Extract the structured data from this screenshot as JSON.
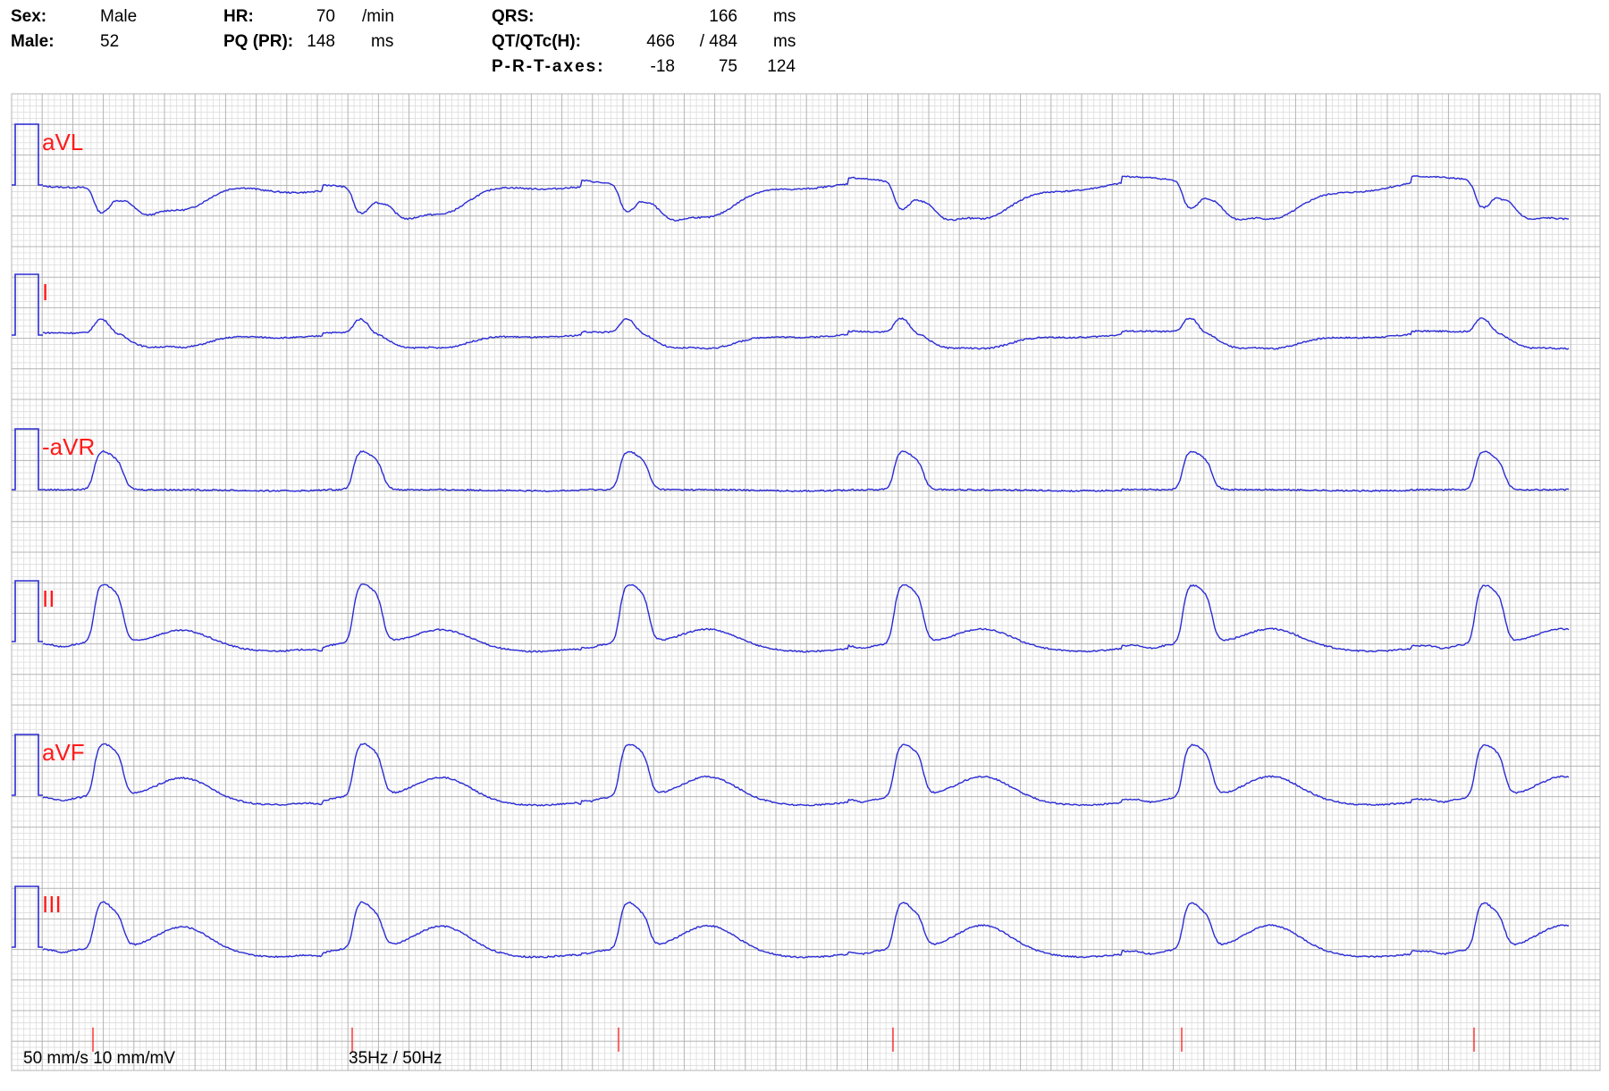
{
  "header": {
    "sex_label": "Sex:",
    "sex_value": "Male",
    "age_label": "Male:",
    "age_value": "52",
    "hr_label": "HR:",
    "hr_value": "70",
    "hr_unit": "/min",
    "pq_label": "PQ (PR):",
    "pq_value": "148",
    "pq_unit": "ms",
    "qrs_label": "QRS:",
    "qrs_value": "166",
    "qrs_unit": "ms",
    "qt_label": "QT/QTc(H):",
    "qt_value": "466",
    "qtc_value": "/ 484",
    "qt_unit": "ms",
    "axes_label": "P-R-T-axes:",
    "axis_p": "-18",
    "axis_r": "75",
    "axis_t": "124"
  },
  "footer": {
    "speed_gain": "50 mm/s 10 mm/mV",
    "filters": "35Hz / 50Hz"
  },
  "colors": {
    "trace": "#2b2bd6",
    "lead_label": "#ff1a1a",
    "grid_minor": "#dcdcdc",
    "grid_major": "#b4b4b4",
    "marker": "#ff1a1a"
  },
  "chart_data": {
    "type": "line",
    "paper_speed_mm_s": 50,
    "gain_mm_mV": 10,
    "heart_rate_bpm": 70,
    "leads": [
      {
        "name": "aVL",
        "beat_template": [
          0,
          0.05,
          0.0,
          -0.4,
          -0.15,
          -0.3,
          -0.5,
          -0.35,
          -0.2
        ]
      },
      {
        "name": "I",
        "beat_template": [
          0,
          0.05,
          0.0,
          0.3,
          0.1,
          -0.05,
          -0.25,
          -0.15,
          -0.1
        ]
      },
      {
        "name": "-aVR",
        "beat_template": [
          0,
          0.0,
          0.0,
          0.65,
          0.55,
          0.0,
          0.0,
          0.0,
          -0.02
        ]
      },
      {
        "name": "II",
        "beat_template": [
          0,
          -0.05,
          -0.05,
          0.95,
          0.85,
          0.05,
          0.25,
          0.0,
          -0.1
        ]
      },
      {
        "name": "aVF",
        "beat_template": [
          0,
          -0.05,
          -0.05,
          0.85,
          0.75,
          0.05,
          0.35,
          0.0,
          -0.1
        ]
      },
      {
        "name": "III",
        "beat_template": [
          0,
          -0.05,
          -0.05,
          0.75,
          0.6,
          0.05,
          0.4,
          0.0,
          -0.1
        ]
      }
    ]
  }
}
